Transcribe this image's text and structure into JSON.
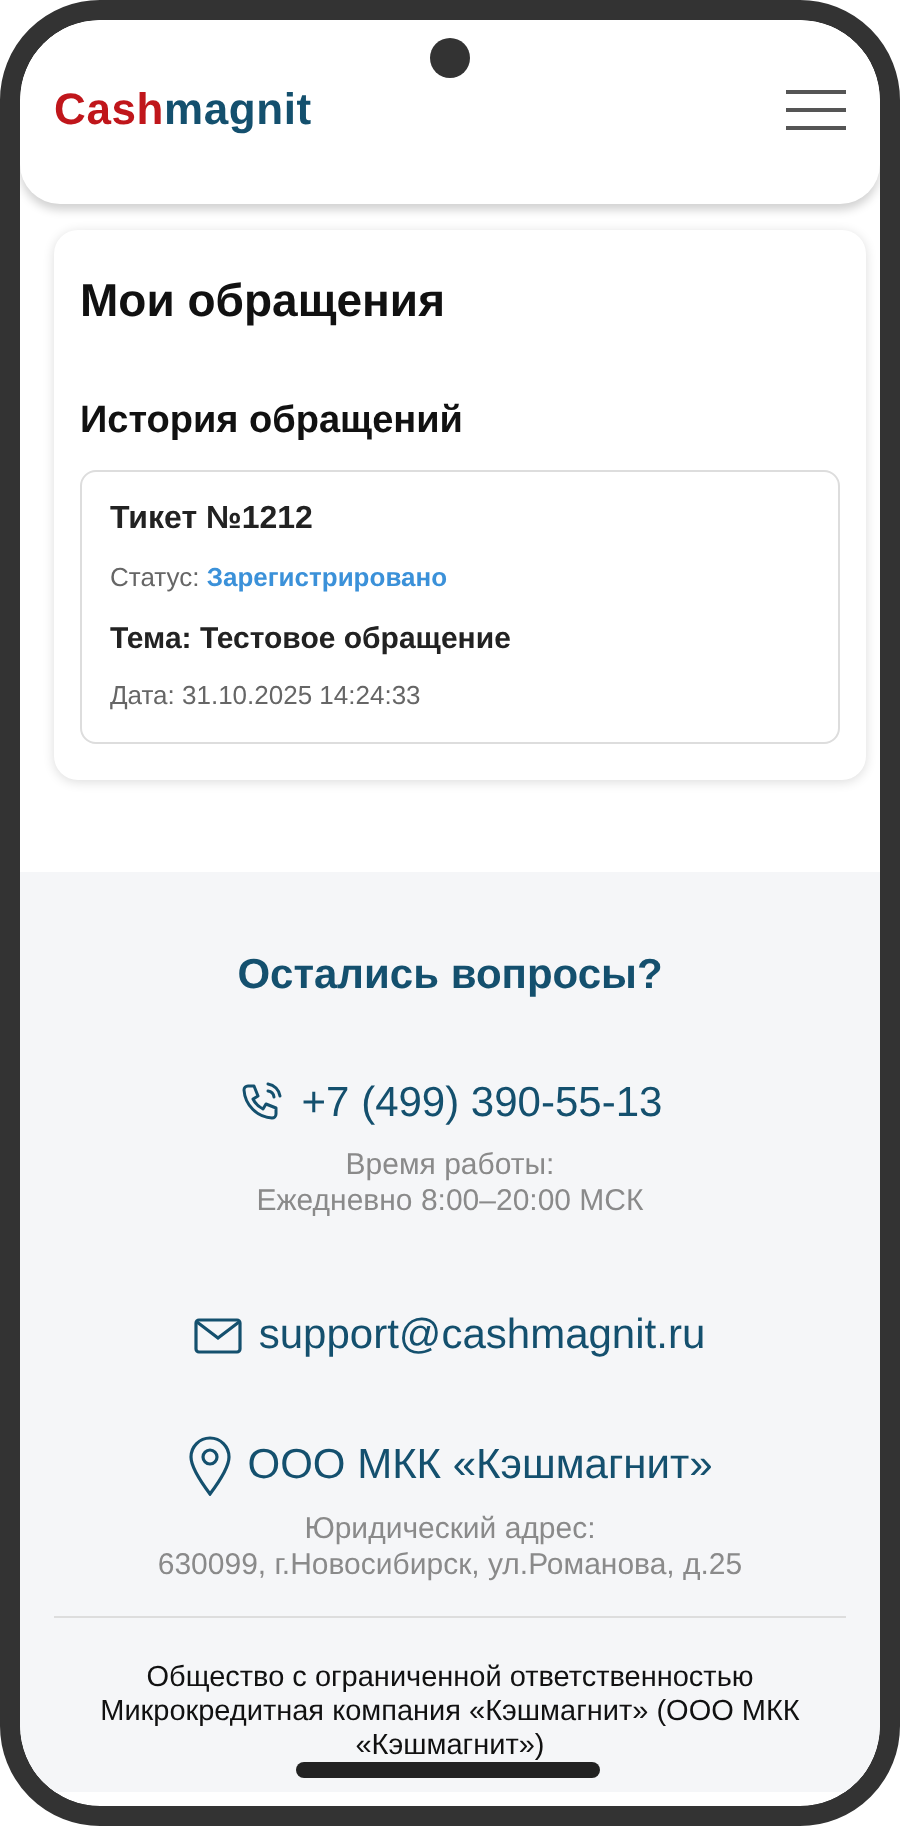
{
  "header": {
    "logo": {
      "first": "Cash",
      "second": "magnit"
    }
  },
  "requests": {
    "title": "Мои обращения",
    "history_title": "История обращений",
    "tickets": [
      {
        "title": "Тикет №1212",
        "status_label": "Статус:",
        "status": "Зарегистрировано",
        "subject": "Тема: Тестовое обращение",
        "date": "Дата: 31.10.2025 14:24:33"
      }
    ]
  },
  "footer": {
    "title": "Остались вопросы?",
    "phone": "+7 (499) 390-55-13",
    "hours": [
      "Время работы:",
      "Ежедневно 8:00–20:00 МСК"
    ],
    "email": "support@cashmagnit.ru",
    "company": "ООО МКК «Кэшмагнит»",
    "address": [
      "Юридический адрес:",
      "630099, г.Новосибирск, ул.Романова, д.25"
    ],
    "legal": "Общество с ограниченной ответственностью Микрокредитная компания «Кэшмагнит» (ООО МКК «Кэшмагнит»)"
  }
}
